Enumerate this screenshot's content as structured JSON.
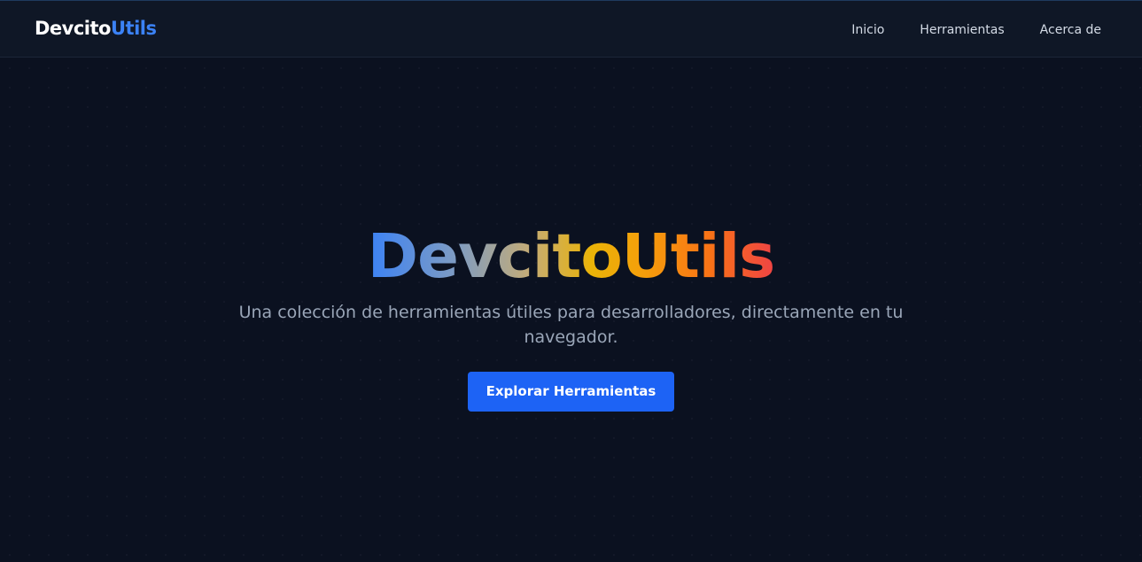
{
  "header": {
    "brand_part1": "Devcito",
    "brand_part2": "Utils",
    "nav": [
      {
        "label": "Inicio"
      },
      {
        "label": "Herramientas"
      },
      {
        "label": "Acerca de"
      }
    ]
  },
  "hero": {
    "title": "DevcitoUtils",
    "subtitle": "Una colección de herramientas útiles para desarrolladores, directamente en tu navegador.",
    "cta_label": "Explorar Herramientas"
  },
  "colors": {
    "background": "#0b1120",
    "navbar": "#0f1726",
    "accent": "#3b82f6",
    "button": "#1d63f5",
    "gradient": [
      "#3b82f6",
      "#7f9cc2",
      "#c5ac76",
      "#eab308",
      "#f59e0b",
      "#f97316",
      "#ef4444"
    ]
  }
}
